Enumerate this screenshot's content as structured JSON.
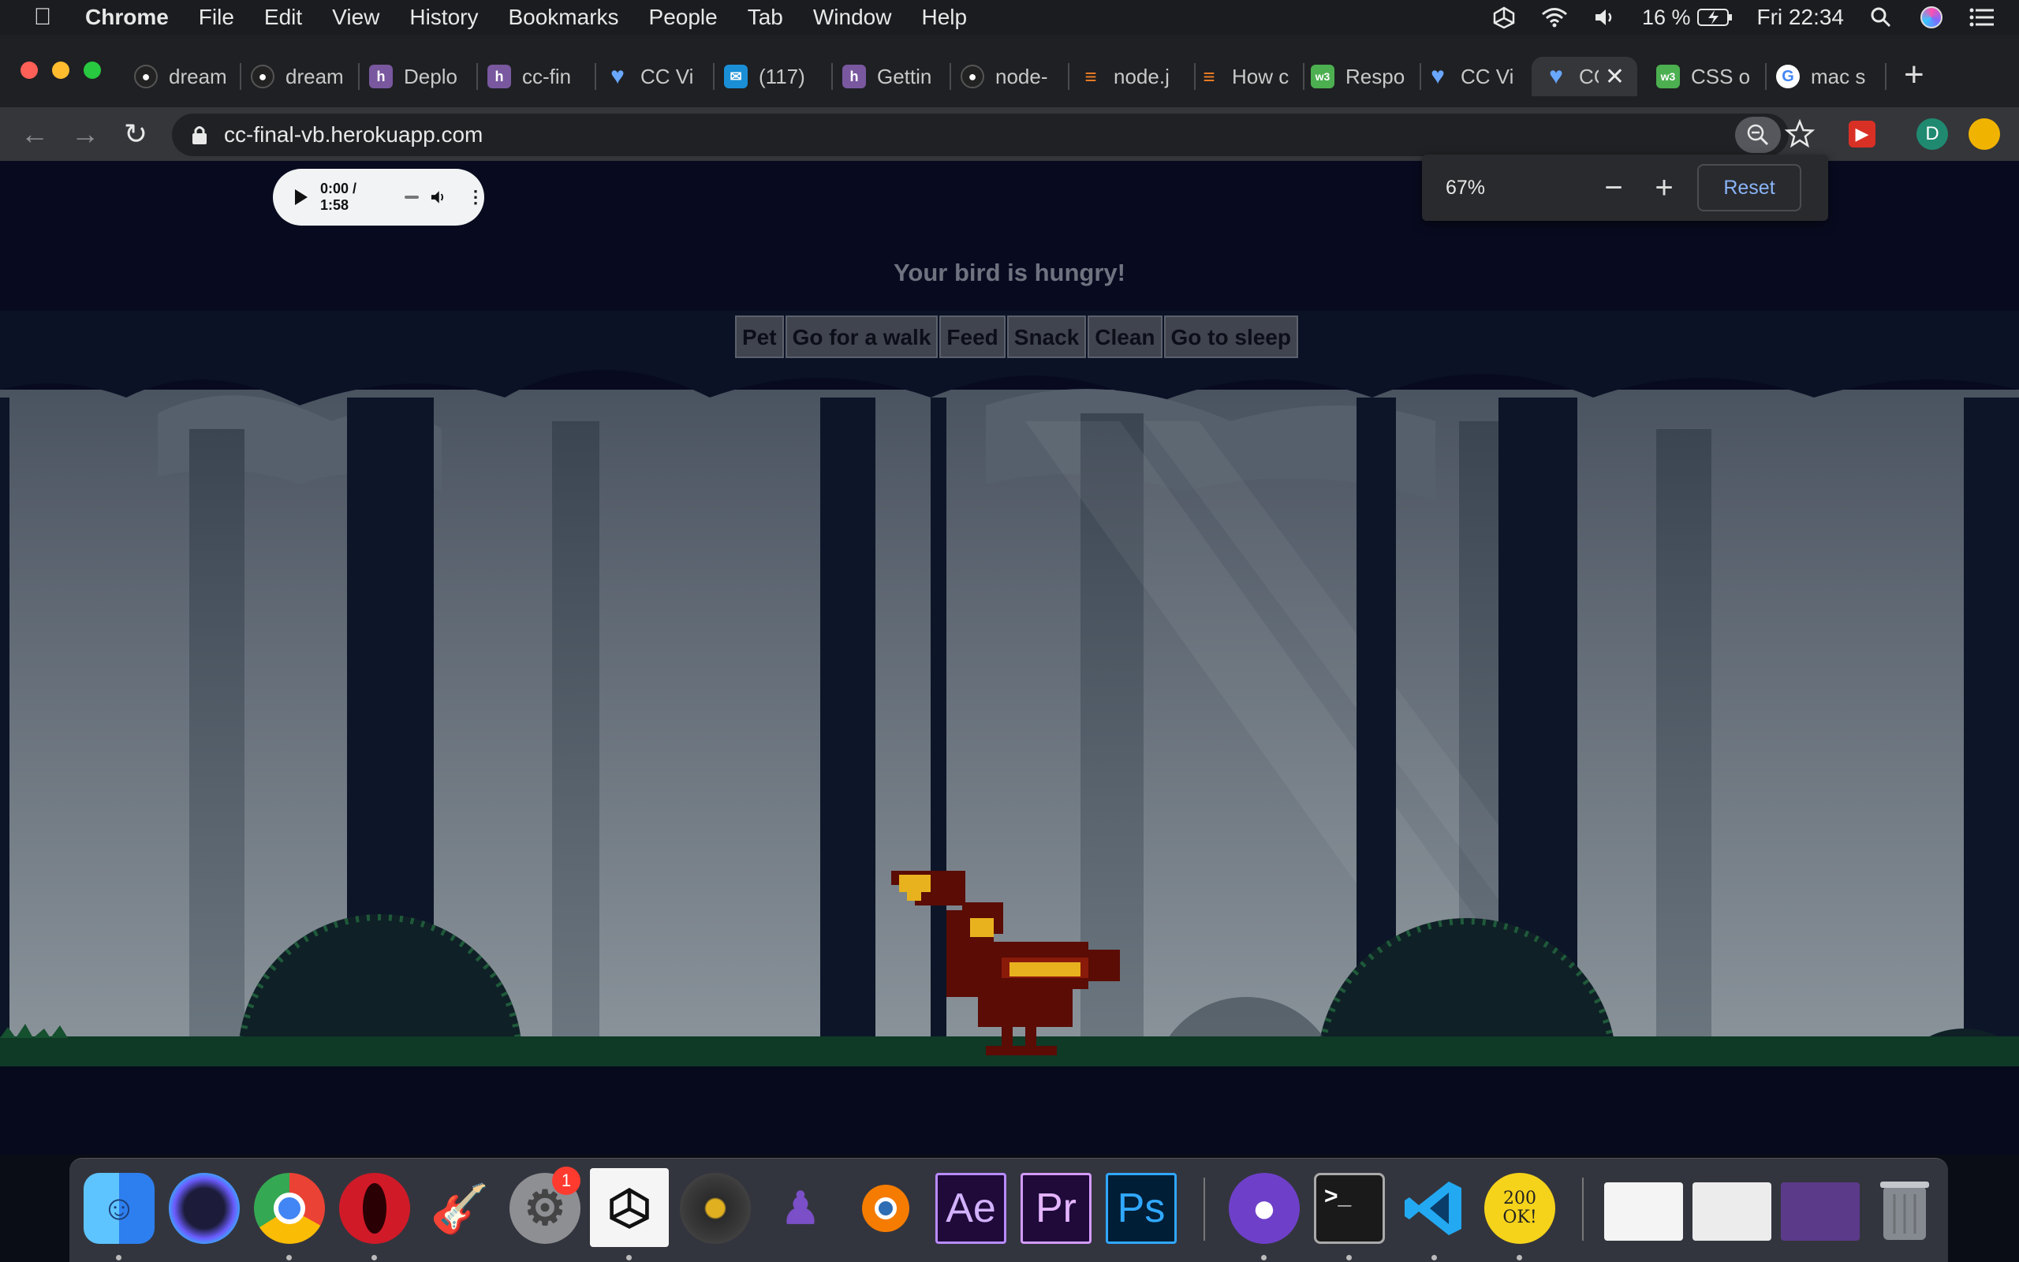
{
  "menubar": {
    "app": "Chrome",
    "items": [
      "File",
      "Edit",
      "View",
      "History",
      "Bookmarks",
      "People",
      "Tab",
      "Window",
      "Help"
    ],
    "battery": "16 %",
    "clock": "Fri 22:34"
  },
  "tabs": [
    {
      "title": "dream",
      "icon": "github-icon"
    },
    {
      "title": "dream",
      "icon": "github-icon"
    },
    {
      "title": "Deplo",
      "icon": "heroku-icon"
    },
    {
      "title": "cc-fin",
      "icon": "heroku-icon"
    },
    {
      "title": "CC Vi",
      "icon": "heart-icon"
    },
    {
      "title": "(117)",
      "icon": "mail-icon"
    },
    {
      "title": "Gettin",
      "icon": "heroku-icon"
    },
    {
      "title": "node-",
      "icon": "github-icon"
    },
    {
      "title": "node.j",
      "icon": "stackoverflow-icon"
    },
    {
      "title": "How c",
      "icon": "stackoverflow-icon"
    },
    {
      "title": "Respo",
      "icon": "w3schools-icon"
    },
    {
      "title": "CC Vi",
      "icon": "heart-icon"
    },
    {
      "title": "CC",
      "icon": "heart-icon",
      "active": true
    },
    {
      "title": "CSS o",
      "icon": "w3schools-icon"
    },
    {
      "title": "mac s",
      "icon": "google-icon"
    }
  ],
  "address": {
    "url": "cc-final-vb.herokuapp.com"
  },
  "profile_initial": "D",
  "zoom_popup": {
    "level": "67%",
    "minus": "−",
    "plus": "+",
    "reset": "Reset"
  },
  "audio": {
    "time": "0:00 / 1:58"
  },
  "game": {
    "status": "Your bird is hungry!",
    "actions": [
      "Pet",
      "Go for a walk",
      "Feed",
      "Snack",
      "Clean",
      "Go to sleep"
    ]
  },
  "dock": {
    "badge": "1",
    "apps": [
      "finder-icon",
      "siri-icon",
      "chrome-icon",
      "opera-icon",
      "garageband-icon",
      "system-preferences-icon",
      "unity-icon",
      "music-player-icon",
      "pixel-character-icon",
      "blender-icon",
      "after-effects-icon",
      "premiere-icon",
      "photoshop-icon",
      "github-desktop-icon",
      "terminal-icon",
      "vscode-icon",
      "200ok-icon"
    ],
    "labels": {
      "ae": "Ae",
      "pr": "Pr",
      "ps": "Ps",
      "terminal": ">_",
      "ok": "200 OK!"
    }
  },
  "colors": {
    "page_bg": "#080b1f",
    "button_bg": "#40444e",
    "status_text": "#6f7380",
    "accent_link": "#8ab4f8",
    "bird_dark": "#5a0c05",
    "bird_light": "#e8b21f"
  }
}
